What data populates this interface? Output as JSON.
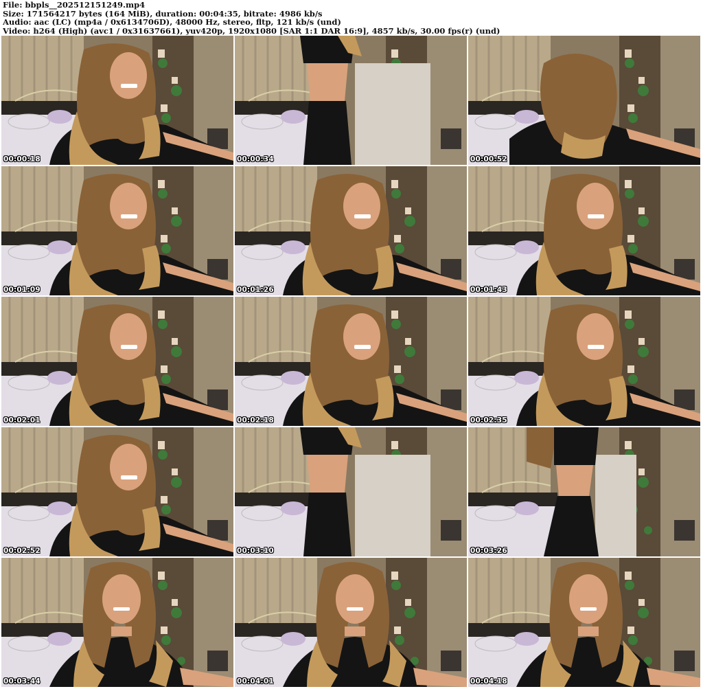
{
  "header": {
    "file_line": "File: bbpls__202512151249.mp4",
    "size_line": "Size: 171564217 bytes (164 MiB), duration: 00:04:35, bitrate: 4986 kb/s",
    "audio_line": "Audio: aac (LC) (mp4a / 0x6134706D), 48000 Hz, stereo, fltp, 121 kb/s (und)",
    "video_line": "Video: h264 (High) (avc1 / 0x31637661), yuv420p, 1920x1080 [SAR 1:1 DAR 16:9], 4857 kb/s, 30.00 fps(r) (und)"
  },
  "thumbnails": [
    {
      "timestamp": "00:00:18",
      "pose": "lean-smile"
    },
    {
      "timestamp": "00:00:34",
      "pose": "standing-torso"
    },
    {
      "timestamp": "00:00:52",
      "pose": "head-down"
    },
    {
      "timestamp": "00:01:09",
      "pose": "lean-smile"
    },
    {
      "timestamp": "00:01:26",
      "pose": "lean-smile"
    },
    {
      "timestamp": "00:01:43",
      "pose": "lean-smile"
    },
    {
      "timestamp": "00:02:01",
      "pose": "lean-smile"
    },
    {
      "timestamp": "00:02:18",
      "pose": "lean-smile"
    },
    {
      "timestamp": "00:02:35",
      "pose": "lean-smile"
    },
    {
      "timestamp": "00:02:52",
      "pose": "lean-smile"
    },
    {
      "timestamp": "00:03:10",
      "pose": "standing-torso"
    },
    {
      "timestamp": "00:03:26",
      "pose": "standing-side"
    },
    {
      "timestamp": "00:03:44",
      "pose": "front-close"
    },
    {
      "timestamp": "00:04:01",
      "pose": "front-close"
    },
    {
      "timestamp": "00:04:18",
      "pose": "front-close"
    }
  ],
  "colors": {
    "wall": "#8a7a62",
    "curtain": "#b9a98a",
    "bed": "#e3dde6",
    "pillow": "#c9b7d6",
    "shelf": "#5a4a38",
    "hair": "#8a6238",
    "hair_light": "#c49a5c",
    "skin": "#d9a27c",
    "clothing": "#141414",
    "timestamp_text": "#ffffff"
  }
}
